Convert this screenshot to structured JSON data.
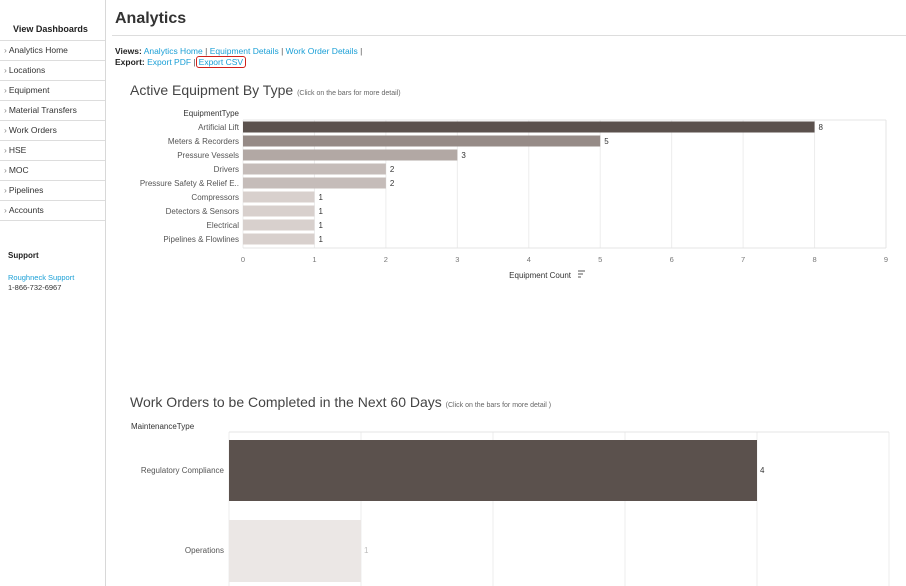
{
  "sidebar": {
    "heading": "View Dashboards",
    "items": [
      {
        "label": "Analytics Home"
      },
      {
        "label": "Locations"
      },
      {
        "label": "Equipment"
      },
      {
        "label": "Material Transfers"
      },
      {
        "label": "Work Orders"
      },
      {
        "label": "HSE"
      },
      {
        "label": "MOC"
      },
      {
        "label": "Pipelines"
      },
      {
        "label": "Accounts"
      }
    ],
    "support_heading": "Support",
    "support_link": "Roughneck Support",
    "support_phone": "1-866-732-6967"
  },
  "header": {
    "title": "Analytics",
    "views_label": "Views:",
    "views_links": [
      "Analytics Home",
      "Equipment Details",
      "Work Order Details"
    ],
    "export_label": "Export:",
    "export_pdf": "Export PDF",
    "export_csv": "Export CSV"
  },
  "chart1": {
    "title": "Active Equipment By Type",
    "hint": "(Click on the bars for more detail)"
  },
  "chart2": {
    "title": "Work Orders to be Completed in the Next 60 Days",
    "hint": "(Click on the bars for more detail )"
  },
  "colors": {
    "link": "#1a9fd6",
    "highlight_border": "#d0201a",
    "bar_dark": "#5b514d",
    "bar_light": "#d6cdca"
  },
  "chart_data": [
    {
      "type": "bar",
      "orientation": "horizontal",
      "title": "Active Equipment By Type",
      "column_header": "EquipmentType",
      "xlabel": "Equipment Count",
      "xlim": [
        0,
        9
      ],
      "ticks": [
        "0",
        "1",
        "2",
        "3",
        "4",
        "5",
        "6",
        "7",
        "8",
        "9"
      ],
      "categories": [
        "Artificial Lift",
        "Meters & Recorders",
        "Pressure Vessels",
        "Drivers",
        "Pressure Safety & Relief E..",
        "Compressors",
        "Detectors & Sensors",
        "Electrical",
        "Pipelines & Flowlines"
      ],
      "values": [
        8,
        5,
        3,
        2,
        2,
        1,
        1,
        1,
        1
      ],
      "value_labels": [
        "8",
        "5",
        "3",
        "2",
        "2",
        "1",
        "1",
        "1",
        "1"
      ],
      "bar_colors": [
        "#5b514d",
        "#968b87",
        "#b2a8a4",
        "#c5bcb9",
        "#c5bcb9",
        "#d8d0cd",
        "#d8d0cd",
        "#d8d0cd",
        "#d8d0cd"
      ],
      "grid": true
    },
    {
      "type": "bar",
      "orientation": "horizontal",
      "title": "Work Orders to be Completed in the Next 60 Days",
      "column_header": "MaintenanceType",
      "xlim": [
        0,
        5
      ],
      "categories": [
        "Regulatory Compliance",
        "Operations"
      ],
      "values": [
        4,
        1
      ],
      "value_labels": [
        "4",
        "1"
      ],
      "bar_colors": [
        "#5b514d",
        "#ebe7e5"
      ],
      "label_colors": [
        "#333333",
        "#bbbbbb"
      ],
      "grid": true
    }
  ]
}
